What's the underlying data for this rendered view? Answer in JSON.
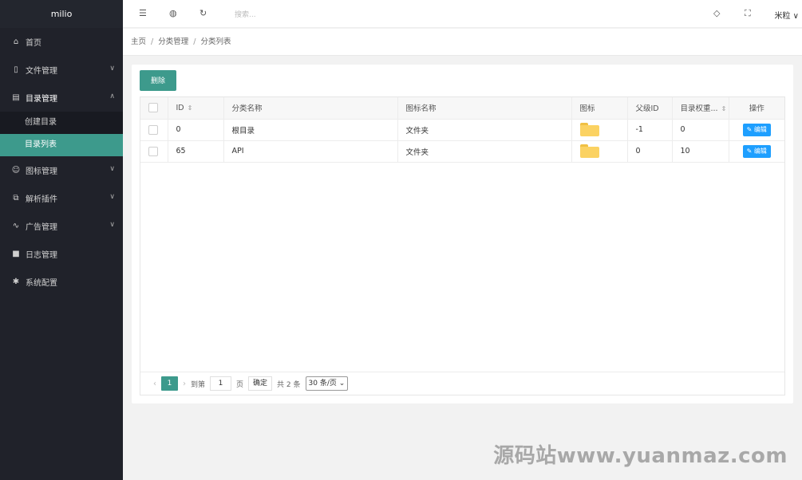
{
  "app": {
    "logo": "milio"
  },
  "sidebar": {
    "items": [
      {
        "label": "首页",
        "icon": "home-icon"
      },
      {
        "label": "文件管理",
        "icon": "file-icon"
      },
      {
        "label": "目录管理",
        "icon": "directory-icon"
      },
      {
        "label": "图标管理",
        "icon": "smile-icon"
      },
      {
        "label": "解析插件",
        "icon": "plugin-icon"
      },
      {
        "label": "广告管理",
        "icon": "pulse-icon"
      },
      {
        "label": "日志管理",
        "icon": "log-icon"
      },
      {
        "label": "系统配置",
        "icon": "gear-icon"
      }
    ],
    "sub_items": [
      {
        "label": "创建目录"
      },
      {
        "label": "目录列表"
      }
    ]
  },
  "header": {
    "search_placeholder": "搜索...",
    "user": "米粒"
  },
  "breadcrumb": [
    "主页",
    "分类管理",
    "分类列表"
  ],
  "toolbar": {
    "delete_label": "删除"
  },
  "table": {
    "columns": [
      "ID",
      "分类名称",
      "图标名称",
      "图标",
      "父级ID",
      "目录权重...",
      "操作"
    ],
    "rows": [
      {
        "id": "0",
        "name": "根目录",
        "icon_name": "文件夹",
        "parent_id": "-1",
        "weight": "0",
        "action": "编辑"
      },
      {
        "id": "65",
        "name": "API",
        "icon_name": "文件夹",
        "parent_id": "0",
        "weight": "10",
        "action": "编辑"
      }
    ]
  },
  "pagination": {
    "current": "1",
    "goto_label": "到第",
    "goto_value": "1",
    "page_label": "页",
    "confirm": "确定",
    "total": "共 2 条",
    "per_page": "30 条/页"
  },
  "watermark": "源码站www.yuanmaz.com",
  "colors": {
    "accent": "#3d9a8c",
    "edit": "#1e9fff",
    "sidebar": "#20222a"
  }
}
